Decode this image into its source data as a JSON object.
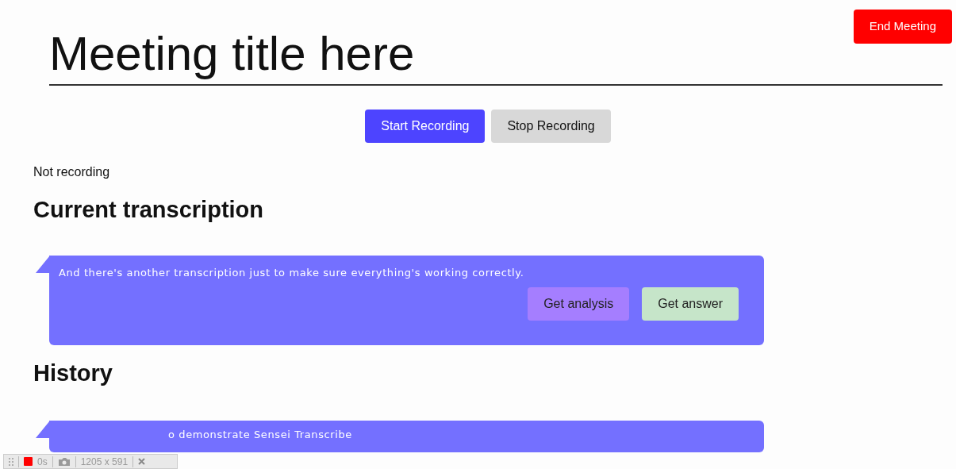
{
  "end_button": "End Meeting",
  "title": "Meeting title here",
  "recording_buttons": [
    {
      "label": "Start Recording",
      "kind": "primary"
    },
    {
      "label": "Stop Recording",
      "kind": "secondary"
    }
  ],
  "status": "Not recording",
  "current_heading": "Current transcription",
  "current": {
    "text": "And there's another transcription just to make sure everything's working correctly.",
    "actions": [
      {
        "label": "Get analysis",
        "kind": "analysis"
      },
      {
        "label": "Get answer",
        "kind": "answer"
      }
    ]
  },
  "history_heading": "History",
  "history": [
    {
      "text": "o demonstrate Sensei Transcribe"
    }
  ],
  "recorder_toolbar": {
    "duration": "0s",
    "size": "1205 x 591"
  }
}
